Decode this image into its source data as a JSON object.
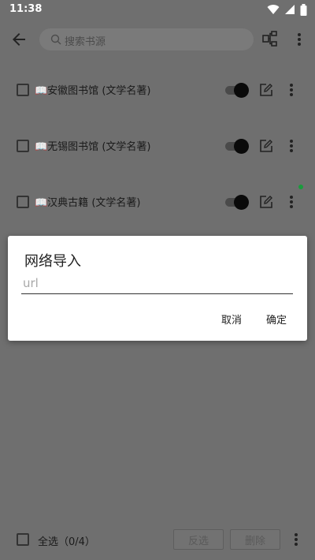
{
  "status_bar": {
    "time": "11:38",
    "icons": [
      "wifi-icon",
      "signal-icon",
      "battery-icon"
    ]
  },
  "toolbar": {
    "back_icon": "arrow-left-icon",
    "search_placeholder": "搜索书源",
    "group_icon": "group-icon",
    "more_icon": "more-vert-icon"
  },
  "sources": [
    {
      "label": "📖安徽图书馆 (文学名著)",
      "checked": false,
      "enabled": true,
      "has_update": false
    },
    {
      "label": "📖无锡图书馆 (文学名著)",
      "checked": false,
      "enabled": true,
      "has_update": false
    },
    {
      "label": "📖汉典古籍 (文学名著)",
      "checked": false,
      "enabled": true,
      "has_update": true
    }
  ],
  "dialog": {
    "title": "网络导入",
    "input_placeholder": "url",
    "input_value": "",
    "cancel_label": "取消",
    "ok_label": "确定"
  },
  "bottom_bar": {
    "select_all_label": "全选（0/4）",
    "invert_label": "反选",
    "delete_label": "删除"
  },
  "colors": {
    "scrim": "#6f6f6f",
    "dialog_bg": "#ffffff",
    "accent_dot": "#1a9b3c"
  }
}
